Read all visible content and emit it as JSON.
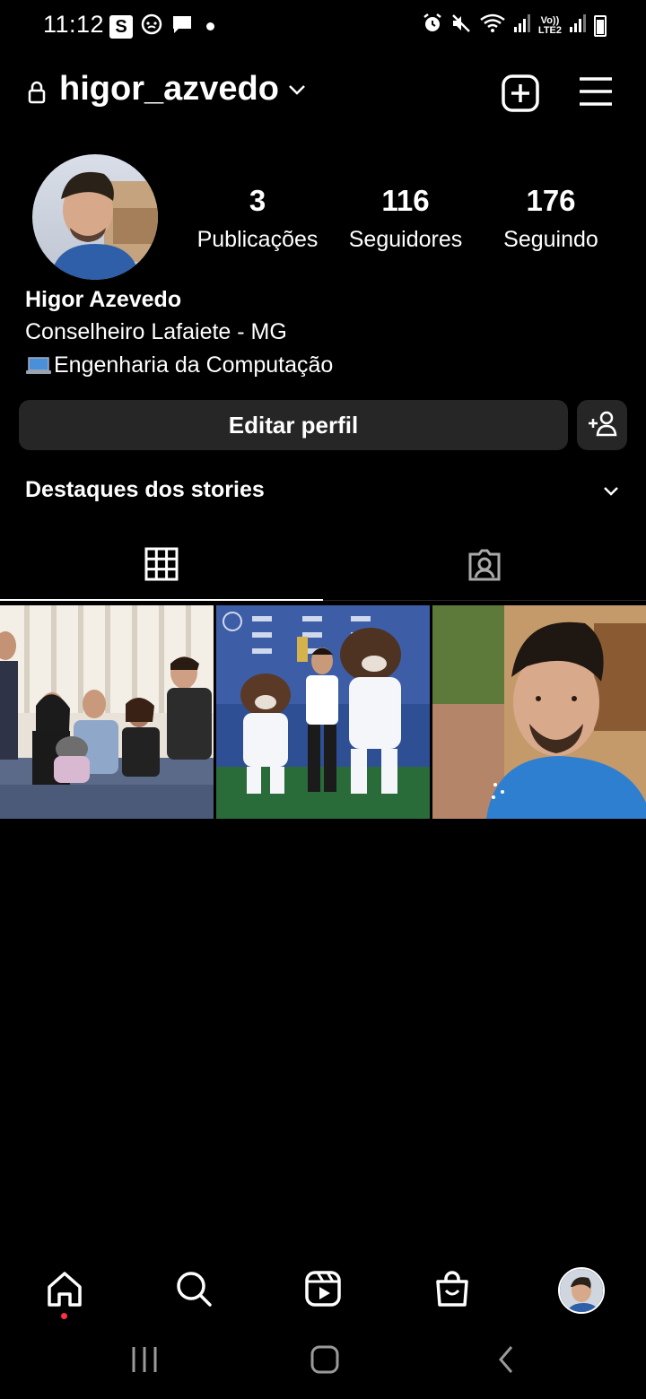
{
  "status_bar": {
    "time": "11:12",
    "s_badge": "S",
    "network": "Vo))\nLTE2"
  },
  "header": {
    "username": "higor_azvedo"
  },
  "profile": {
    "stats": [
      {
        "value": "3",
        "label": "Publicações"
      },
      {
        "value": "116",
        "label": "Seguidores"
      },
      {
        "value": "176",
        "label": "Seguindo"
      }
    ],
    "full_name": "Higor Azevedo",
    "bio_lines": [
      "Conselheiro Lafaiete - MG",
      "Engenharia da Computação"
    ],
    "edit_button": "Editar perfil"
  },
  "highlights": {
    "title": "Destaques dos stories"
  },
  "tabs": [
    {
      "name": "grid",
      "active": true
    },
    {
      "name": "tagged",
      "active": false
    }
  ],
  "posts": [
    {
      "scene": "family group photo"
    },
    {
      "scene": "mascots with person"
    },
    {
      "scene": "selfie"
    }
  ],
  "bottom_nav": {
    "items": [
      "home-icon",
      "search-icon",
      "reels-icon",
      "shop-icon",
      "profile-avatar"
    ],
    "notification_color": "#ff3040"
  }
}
